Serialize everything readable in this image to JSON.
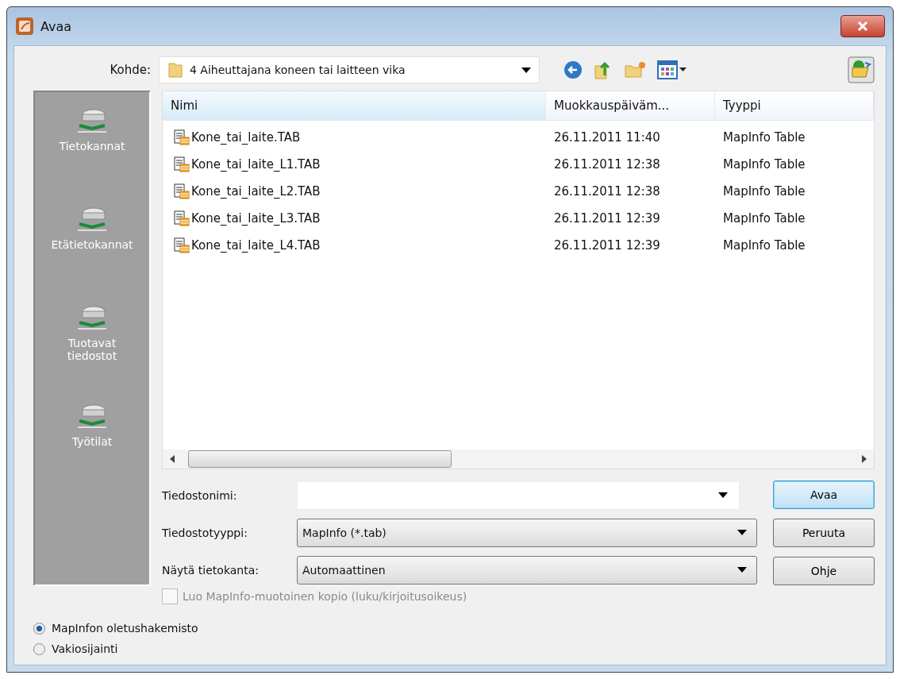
{
  "window": {
    "title": "Avaa"
  },
  "location": {
    "label": "Kohde:",
    "value": "4 Aiheuttajana koneen tai laitteen vika"
  },
  "sidebar": {
    "items": [
      {
        "label": "Tietokannat",
        "selected": false
      },
      {
        "label": "Etätietokannat",
        "selected": false
      },
      {
        "label": "Tuotavat tiedostot",
        "selected": false
      },
      {
        "label": "Työtilat",
        "selected": false
      }
    ]
  },
  "table": {
    "columns": [
      "Nimi",
      "Muokkauspäiväm...",
      "Tyyppi"
    ],
    "rows": [
      {
        "name": "Kone_tai_laite.TAB",
        "modified": "26.11.2011 11:40",
        "type": "MapInfo Table",
        "selected": false
      },
      {
        "name": "Kone_tai_laite_L1.TAB",
        "modified": "26.11.2011 12:38",
        "type": "MapInfo Table",
        "selected": false
      },
      {
        "name": "Kone_tai_laite_L2.TAB",
        "modified": "26.11.2011 12:38",
        "type": "MapInfo Table",
        "selected": false
      },
      {
        "name": "Kone_tai_laite_L3.TAB",
        "modified": "26.11.2011 12:39",
        "type": "MapInfo Table",
        "selected": false
      },
      {
        "name": "Kone_tai_laite_L4.TAB",
        "modified": "26.11.2011 12:39",
        "type": "MapInfo Table",
        "selected": false
      }
    ]
  },
  "fields": [
    {
      "kind": "combo",
      "label": "Tiedostonimi:"
    },
    {
      "kind": "dropdown",
      "label": "Tiedostotyyppi:",
      "value": "MapInfo (*.tab)"
    },
    {
      "kind": "dropdown",
      "label": "Näytä tietokanta:",
      "value": "Automaattinen"
    }
  ],
  "buttons": [
    {
      "label": "Avaa",
      "default": true
    },
    {
      "label": "Peruuta",
      "default": false
    },
    {
      "label": "Ohje",
      "default": false
    }
  ],
  "copy_option": {
    "label": "Luo MapInfo-muotoinen kopio (luku/kirjoitusoikeus)",
    "checked": false,
    "disabled": true
  },
  "location_options": [
    {
      "label": "MapInfon oletushakemisto",
      "selected": true
    },
    {
      "label": "Vakiosijainti",
      "selected": false
    }
  ]
}
